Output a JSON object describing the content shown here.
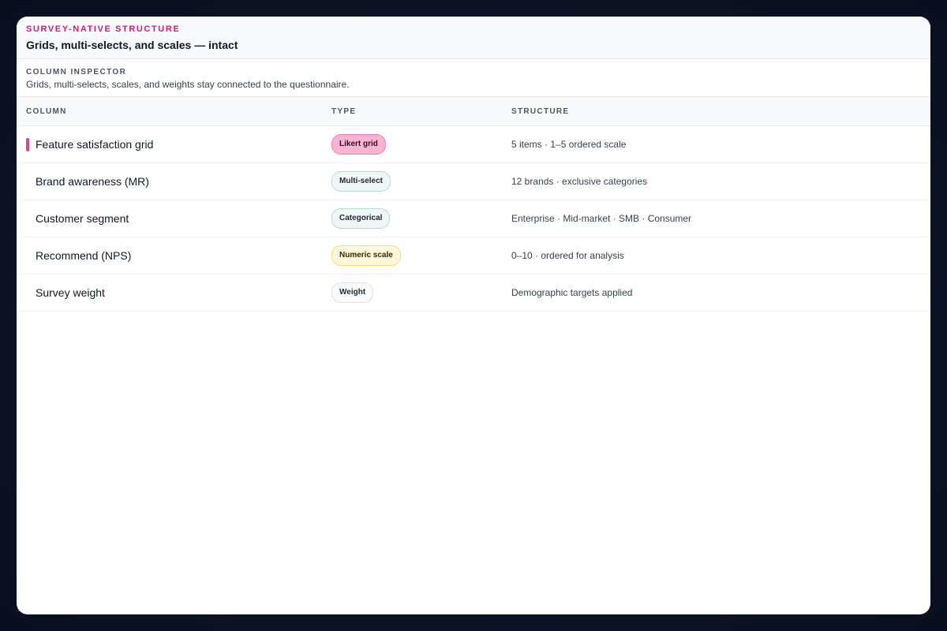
{
  "header": {
    "eyebrow": "SURVEY-NATIVE STRUCTURE",
    "title": "Grids, multi-selects, and scales — intact"
  },
  "inspector": {
    "label": "COLUMN INSPECTOR",
    "description": "Grids, multi-selects, scales, and weights stay connected to the questionnaire."
  },
  "table": {
    "columns": [
      "COLUMN",
      "TYPE",
      "STRUCTURE"
    ],
    "rows": [
      {
        "name": "Feature satisfaction grid",
        "type": "Likert grid",
        "structure": "5 items · 1–5 ordered scale",
        "selected": true
      },
      {
        "name": "Brand awareness (MR)",
        "type": "Multi-select",
        "structure": "12 brands · exclusive categories"
      },
      {
        "name": "Customer segment",
        "type": "Categorical",
        "structure": "Enterprise · Mid-market · SMB · Consumer"
      },
      {
        "name": "Recommend (NPS)",
        "type": "Numeric scale",
        "structure": "0–10 · ordered for analysis"
      },
      {
        "name": "Survey weight",
        "type": "Weight",
        "structure": "Demographic targets applied"
      }
    ]
  },
  "colors": {
    "accent": "#d61a77",
    "selected_bar": "#e0457f",
    "background": "#0d1226"
  }
}
